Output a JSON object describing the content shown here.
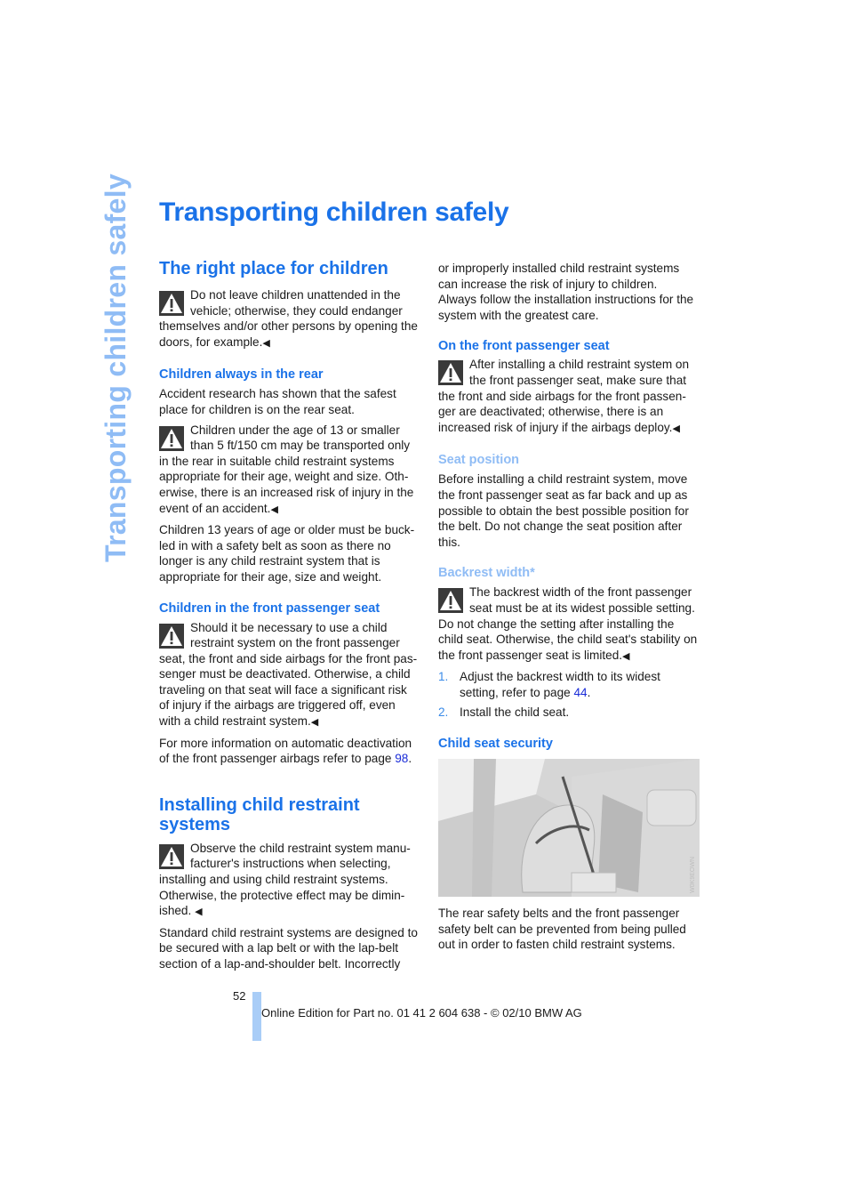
{
  "side_title": "Transporting children safely",
  "page_title": "Transporting children safely",
  "left_column": {
    "section1_heading": "The right place for children",
    "warn1": "Do not leave children unattended in the vehicle; otherwise, they could endanger themselves and/or other persons by opening the doors, for example.",
    "sub1_heading": "Children always in the rear",
    "sub1_para": "Accident research has shown that the safest place for children is on the rear seat.",
    "warn2": "Children under the age of 13 or smaller than 5 ft/150 cm may be transported only in the rear in suitable child restraint systems appropriate for their age, weight and size. Oth­erwise, there is an increased risk of injury in the event of an accident.",
    "sub1_para2": "Children 13 years of age or older must be buck­led in with a safety belt as soon as there no longer is any child restraint system that is appropriate for their age, size and weight.",
    "sub2_heading": "Children in the front passenger seat",
    "warn3": "Should it be necessary to use a child restraint system on the front passenger seat, the front and side airbags for the front pas­senger must be deactivated. Otherwise, a child traveling on that seat will face a significant risk of injury if the airbags are triggered off, even with a child restraint system.",
    "sub2_para_prefix": "For more information on automatic deactivation of the front passenger airbags refer to page ",
    "sub2_para_link": "98",
    "sub2_para_suffix": ".",
    "section2_heading": "Installing child restraint systems",
    "warn4": "Observe the child restraint system manu­facturer's instructions when selecting, installing and using child restraint systems. Otherwise, the protective effect may be dimin­ished. ",
    "section2_para": "Standard child restraint systems are designed to be secured with a lap belt or with the lap-belt section of a lap-and-shoulder belt. Incorrectly"
  },
  "right_column": {
    "continued_para": "or improperly installed child restraint systems can increase the risk of injury to children. Always follow the installation instructions for the system with the greatest care.",
    "sub3_heading": "On the front passenger seat",
    "warn5": "After installing a child restraint system on the front passenger seat, make sure that the front and side airbags for the front passen­ger are deactivated; otherwise, there is an increased risk of injury if the airbags deploy.",
    "sub4_heading": "Seat position",
    "sub4_para": "Before installing a child restraint system, move the front passenger seat as far back and up as possible to obtain the best possible position for the belt. Do not change the seat position after this.",
    "sub5_heading": "Backrest width*",
    "warn6": "The backrest width of the front passenger seat must be at its widest possible set­ting. Do not change the setting after installing the child seat. Otherwise, the child seat's stabil­ity on the front passenger seat is limited.",
    "steps": [
      {
        "num": "1.",
        "text_prefix": "Adjust the backrest width to its widest setting, refer to page ",
        "link": "44",
        "text_suffix": "."
      },
      {
        "num": "2.",
        "text_prefix": "Install the child seat.",
        "link": "",
        "text_suffix": ""
      }
    ],
    "sub6_heading": "Child seat security",
    "figure_code": "W0K9EOWN",
    "figure_caption": "The rear safety belts and the front passenger safety belt can be prevented from being pulled out in order to fasten child restraint systems."
  },
  "end_mark": "◀",
  "footer": {
    "page_number": "52",
    "text": "Online Edition for Part no. 01 41 2 604 638 - © 02/10 BMW AG"
  },
  "colors": {
    "heading_blue": "#1a72e8",
    "light_blue": "#8fbcf5",
    "link_blue": "#1a2cd8",
    "footer_bar": "#a9cdf7"
  }
}
